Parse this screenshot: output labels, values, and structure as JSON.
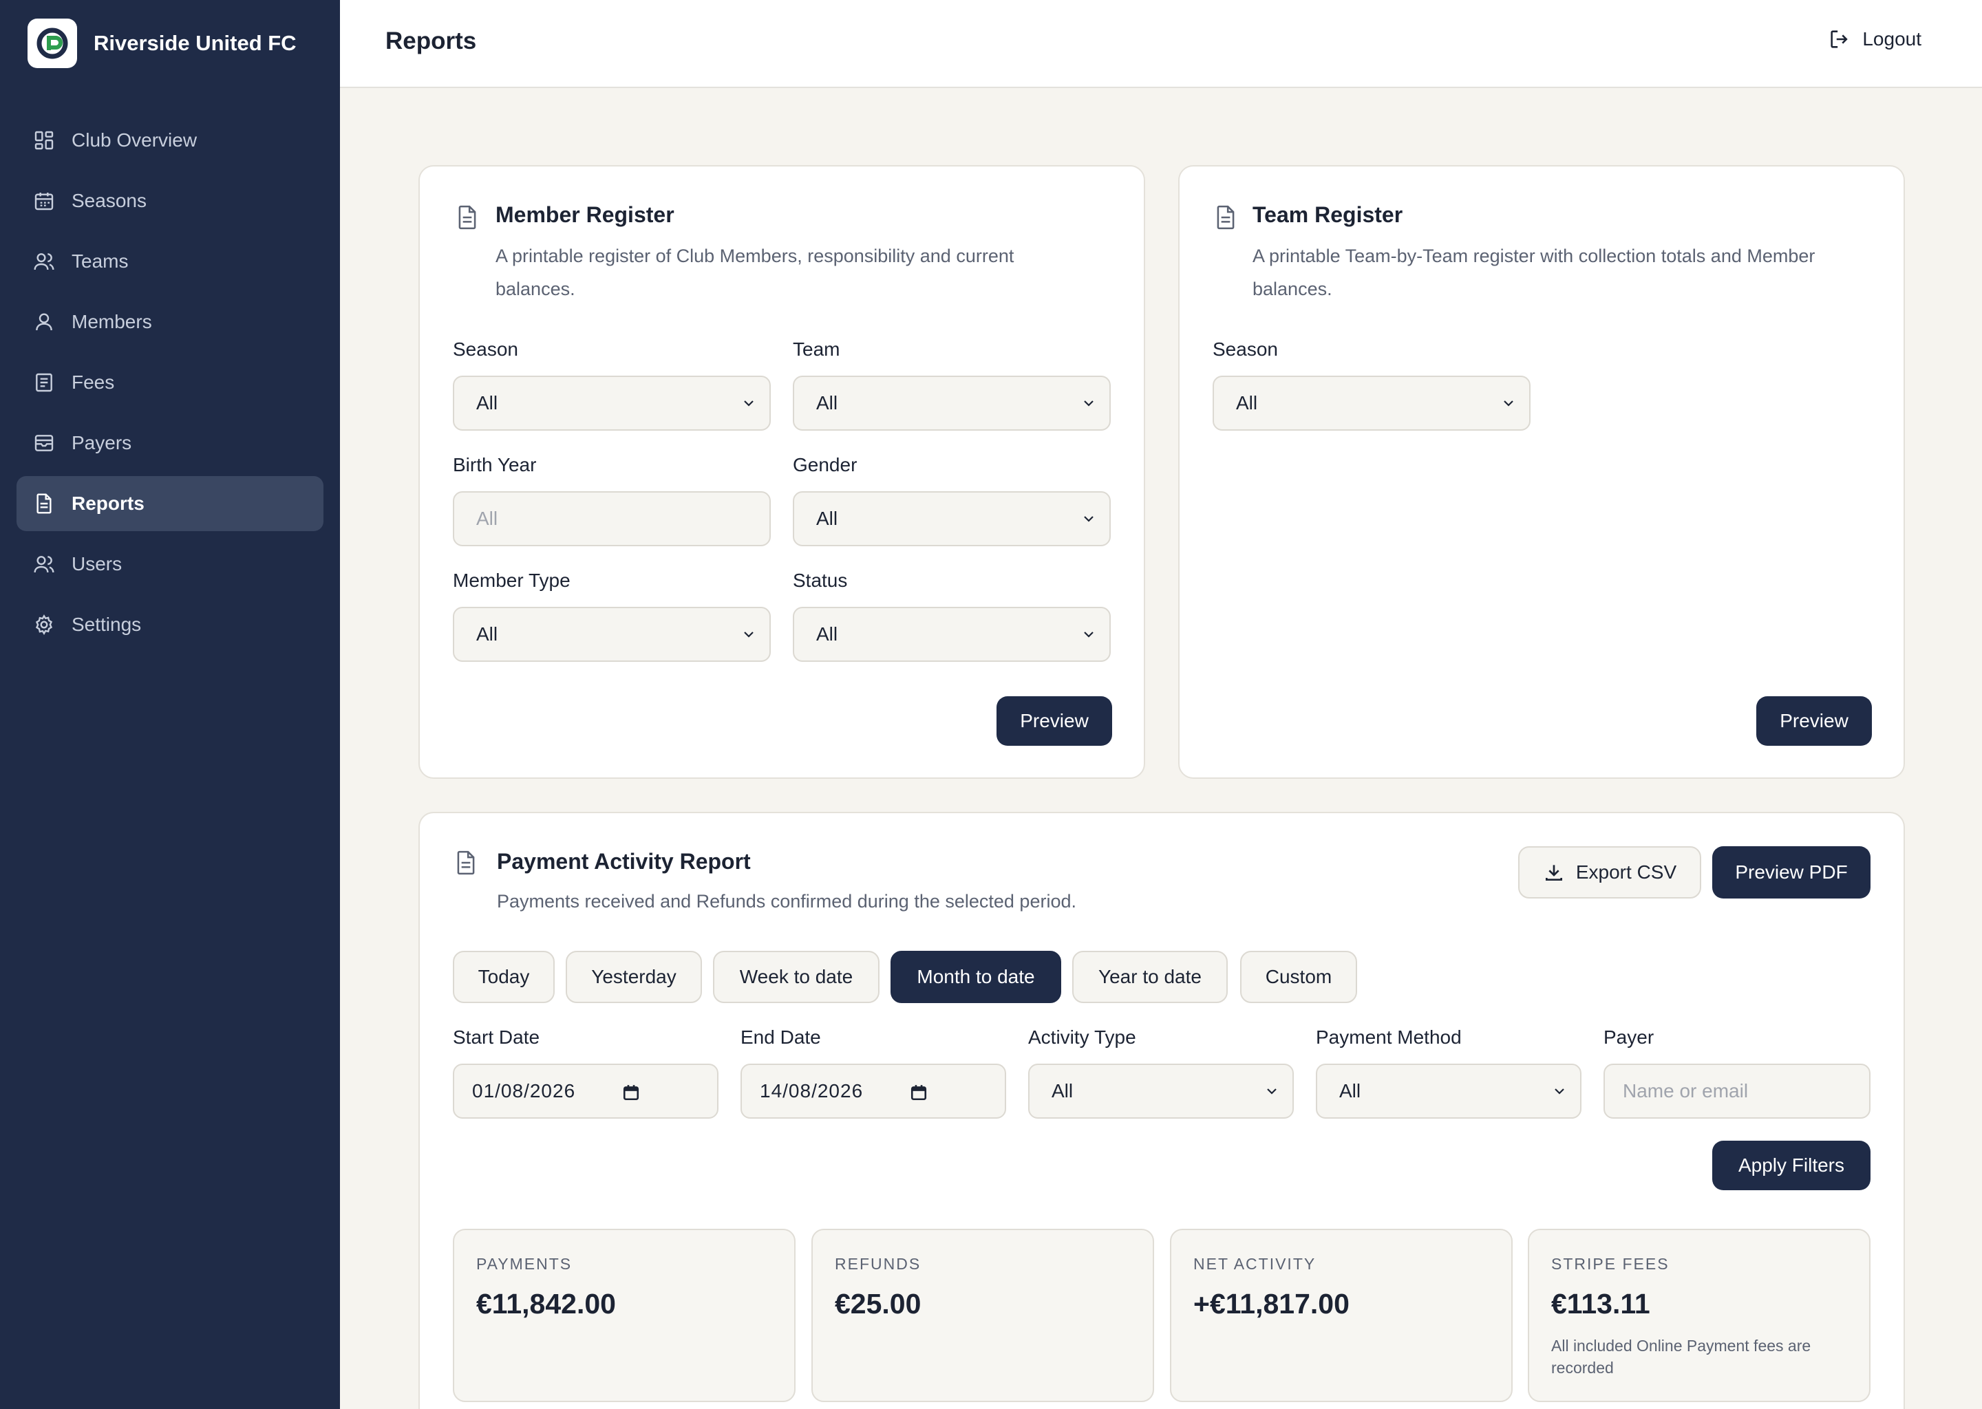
{
  "brand": {
    "name": "Riverside United FC"
  },
  "nav": {
    "items": [
      {
        "label": "Club Overview",
        "icon": "grid-icon"
      },
      {
        "label": "Seasons",
        "icon": "calendar-icon"
      },
      {
        "label": "Teams",
        "icon": "users-icon"
      },
      {
        "label": "Members",
        "icon": "user-icon"
      },
      {
        "label": "Fees",
        "icon": "receipt-icon"
      },
      {
        "label": "Payers",
        "icon": "wallet-icon"
      },
      {
        "label": "Reports",
        "icon": "document-icon",
        "active": true
      },
      {
        "label": "Users",
        "icon": "users-icon"
      },
      {
        "label": "Settings",
        "icon": "gear-icon"
      }
    ]
  },
  "header": {
    "title": "Reports",
    "logout_label": "Logout"
  },
  "member_register": {
    "title": "Member Register",
    "description": "A printable register of Club Members, responsibility and current balances.",
    "season_label": "Season",
    "season_value": "All",
    "team_label": "Team",
    "team_value": "All",
    "birth_year_label": "Birth Year",
    "birth_year_placeholder": "All",
    "gender_label": "Gender",
    "gender_value": "All",
    "member_type_label": "Member Type",
    "member_type_value": "All",
    "status_label": "Status",
    "status_value": "All",
    "preview_label": "Preview"
  },
  "team_register": {
    "title": "Team Register",
    "description": "A printable Team-by-Team register with collection totals and Member balances.",
    "season_label": "Season",
    "season_value": "All",
    "preview_label": "Preview"
  },
  "payment_report": {
    "title": "Payment Activity Report",
    "description": "Payments received and Refunds confirmed during the selected period.",
    "export_label": "Export CSV",
    "preview_pdf_label": "Preview PDF",
    "ranges": [
      "Today",
      "Yesterday",
      "Week to date",
      "Month to date",
      "Year to date",
      "Custom"
    ],
    "active_range": "Month to date",
    "start_date_label": "Start Date",
    "start_date_value": "01/08/2026",
    "end_date_label": "End Date",
    "end_date_value": "14/08/2026",
    "activity_type_label": "Activity Type",
    "activity_type_value": "All",
    "payment_method_label": "Payment Method",
    "payment_method_value": "All",
    "payer_label": "Payer",
    "payer_placeholder": "Name or email",
    "apply_label": "Apply Filters",
    "stats": [
      {
        "label": "PAYMENTS",
        "value": "€11,842.00"
      },
      {
        "label": "REFUNDS",
        "value": "€25.00"
      },
      {
        "label": "NET ACTIVITY",
        "value": "+€11,817.00"
      },
      {
        "label": "STRIPE FEES",
        "value": "€113.11",
        "note": "All included Online Payment fees are recorded"
      }
    ]
  }
}
